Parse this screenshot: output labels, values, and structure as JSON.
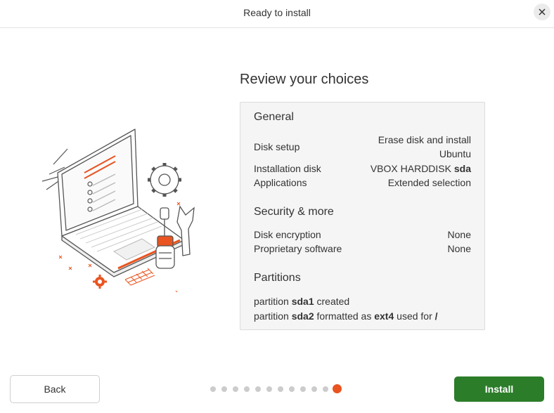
{
  "header": {
    "title": "Ready to install"
  },
  "review": {
    "title": "Review your choices",
    "general": {
      "title": "General",
      "disk_setup_label": "Disk setup",
      "disk_setup_value_1": "Erase disk and install",
      "disk_setup_value_2": "Ubuntu",
      "installation_disk_label": "Installation disk",
      "installation_disk_value": "VBOX HARDDISK",
      "installation_disk_device": "sda",
      "applications_label": "Applications",
      "applications_value": "Extended selection"
    },
    "security": {
      "title": "Security & more",
      "disk_encryption_label": "Disk encryption",
      "disk_encryption_value": "None",
      "proprietary_label": "Proprietary software",
      "proprietary_value": "None"
    },
    "partitions": {
      "title": "Partitions",
      "p1_prefix": "partition",
      "p1_device": "sda1",
      "p1_suffix": "created",
      "p2_prefix": "partition",
      "p2_device": "sda2",
      "p2_mid": "formatted as",
      "p2_fs": "ext4",
      "p2_used": "used for",
      "p2_mount": "/"
    }
  },
  "footer": {
    "back_label": "Back",
    "install_label": "Install",
    "steps_total": 12,
    "steps_current": 12
  },
  "colors": {
    "accent": "#e95420",
    "install_button": "#2c7d2a",
    "panel_bg": "#f5f5f5"
  },
  "icons": {
    "close": "close-icon",
    "illustration": "laptop-tools-illustration"
  }
}
